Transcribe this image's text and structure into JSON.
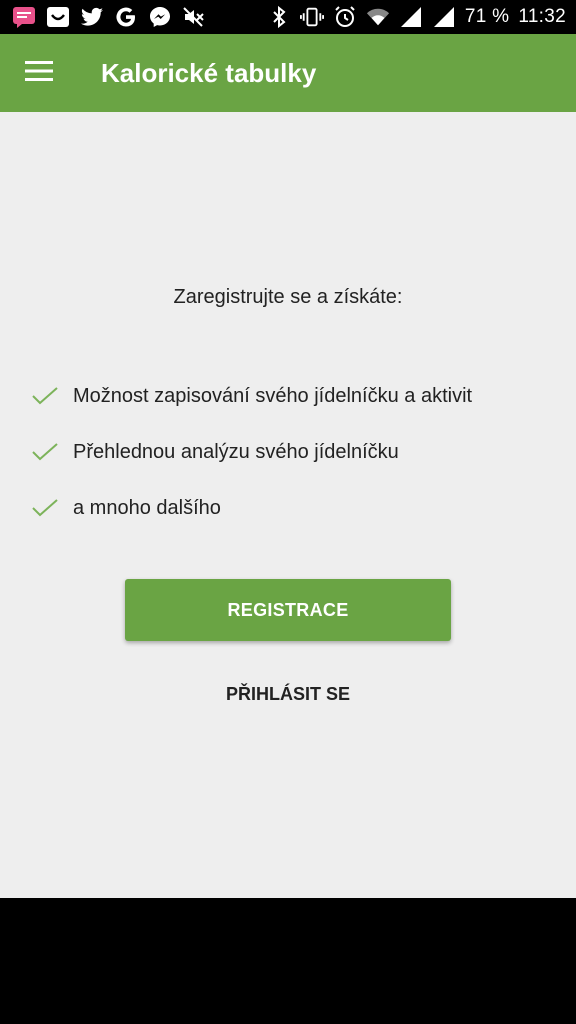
{
  "status_bar": {
    "battery": "71 %",
    "time": "11:32",
    "left_icons": [
      "chat-bubble-icon",
      "smile-box-icon",
      "twitter-icon",
      "google-icon",
      "messenger-icon",
      "mute-icon"
    ],
    "right_icons": [
      "bluetooth-icon",
      "vibrate-icon",
      "alarm-icon",
      "wifi-icon",
      "signal-icon",
      "signal-icon"
    ]
  },
  "app_bar": {
    "title": "Kalorické tabulky",
    "menu_icon": "hamburger-menu-icon",
    "color": "#6aa444"
  },
  "main": {
    "headline": "Zaregistrujte se a získáte:",
    "benefits": [
      {
        "label": "Možnost zapisování svého jídelníčku a aktivit"
      },
      {
        "label": "Přehlednou analýzu svého jídelníčku"
      },
      {
        "label": "a mnoho dalšího"
      }
    ],
    "register_label": "REGISTRACE",
    "login_label": "PŘIHLÁSIT SE"
  },
  "colors": {
    "accent": "#6aa444",
    "background": "#eeeeee",
    "check": "#7cb35a"
  }
}
